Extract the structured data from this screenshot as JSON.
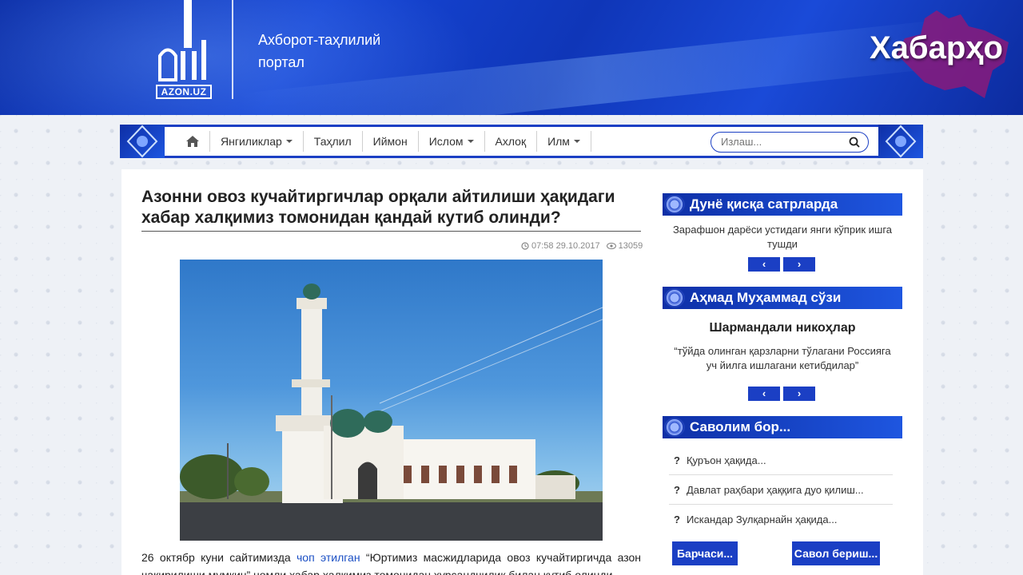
{
  "header": {
    "logo_text": "AZON.UZ",
    "tagline_line1": "Ахборот-таҳлилий",
    "tagline_line2": "портал",
    "brand": "Хабарҳо"
  },
  "nav": {
    "items": [
      {
        "label": "Янгиликлар",
        "dropdown": true
      },
      {
        "label": "Таҳлил",
        "dropdown": false
      },
      {
        "label": "Иймон",
        "dropdown": false
      },
      {
        "label": "Ислом",
        "dropdown": true
      },
      {
        "label": "Ахлоқ",
        "dropdown": false
      },
      {
        "label": "Илм",
        "dropdown": true
      }
    ],
    "search_placeholder": "Излаш..."
  },
  "article": {
    "title": "Азонни овоз кучайтиргичлар орқали айтилиши ҳақидаги хабар халқимиз томонидан қандай кутиб олинди?",
    "time": "07:58 29.10.2017",
    "views": "13059",
    "text_before_link": "26 октябр куни сайтимизда ",
    "link": "чоп этилган",
    "text_after_link": " “Юртимиз масжидларида овоз кучайтиргичда азон чақирилиши мумкин” номли хабар халқимиз томонидан хурсандчилик билан кутиб олинди."
  },
  "sidebar": {
    "news_head": "Дунё қисқа сатрларда",
    "news_text": "Зарафшон дарёси устидаги янги кўприк ишга тушди",
    "quote_head": "Аҳмад Муҳаммад сўзи",
    "quote_title": "Шармандали никоҳлар",
    "quote_text": "“тўйда олинган қарзларни тўлагани Россияга уч йилга ишлагани кетибдилар”",
    "qa_head": "Саволим бор...",
    "questions": [
      "Қуръон ҳақида...",
      "Давлат раҳбари ҳаққига дуо қилиш...",
      "Искандар Зулқарнайн ҳақида..."
    ],
    "all_button": "Барчаси...",
    "ask_button": "Савол бериш..."
  },
  "colors": {
    "primary": "#1b3fc4",
    "header": "#1646d6"
  }
}
